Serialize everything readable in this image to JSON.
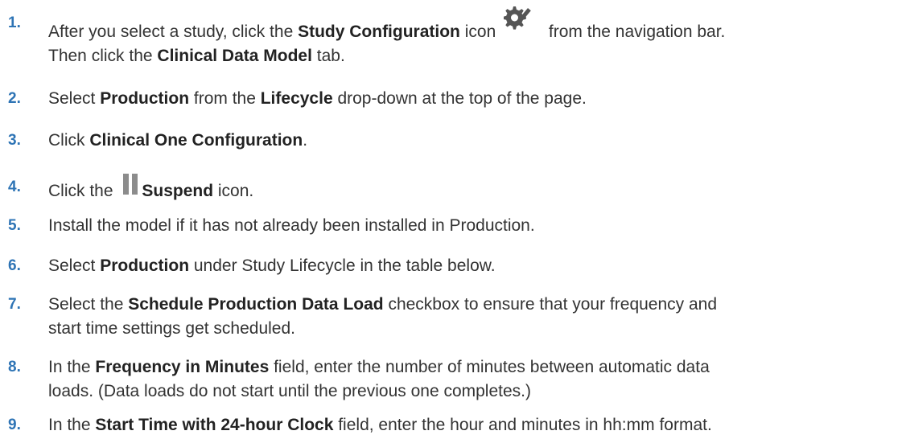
{
  "steps": [
    {
      "number": "1.",
      "parts": {
        "a": "After you select a study, click the ",
        "b": "Study Configuration",
        "c": " icon ",
        "icon": "gear-pencil-icon",
        "d": " from the navigation bar.",
        "e": "Then click the ",
        "f": "Clinical Data Model",
        "g": " tab."
      }
    },
    {
      "number": "2.",
      "parts": {
        "a": "Select ",
        "b": "Production",
        "c": " from the ",
        "d": "Lifecycle",
        "e": " drop-down at the top of the page."
      }
    },
    {
      "number": "3.",
      "parts": {
        "a": "Click ",
        "b": "Clinical One Configuration",
        "c": "."
      }
    },
    {
      "number": "4.",
      "parts": {
        "a": "Click the ",
        "icon": "pause-icon",
        "b": "Suspend",
        "c": " icon."
      }
    },
    {
      "number": "5.",
      "parts": {
        "a": "Install the model if it has not already been installed in Production."
      }
    },
    {
      "number": "6.",
      "parts": {
        "a": "Select ",
        "b": "Production",
        "c": " under Study Lifecycle in the table below."
      }
    },
    {
      "number": "7.",
      "parts": {
        "a": "Select the ",
        "b": "Schedule Production Data Load",
        "c": " checkbox to ensure that your frequency and",
        "d": "start time settings get scheduled."
      }
    },
    {
      "number": "8.",
      "parts": {
        "a": "In the ",
        "b": "Frequency in Minutes",
        "c": " field, enter the number of minutes between automatic data",
        "d": "loads. (Data loads do not start until the previous one completes.)"
      }
    },
    {
      "number": "9.",
      "parts": {
        "a": "In the ",
        "b": "Start Time with 24-hour Clock",
        "c": " field, enter the hour and minutes in hh:mm format."
      }
    }
  ]
}
